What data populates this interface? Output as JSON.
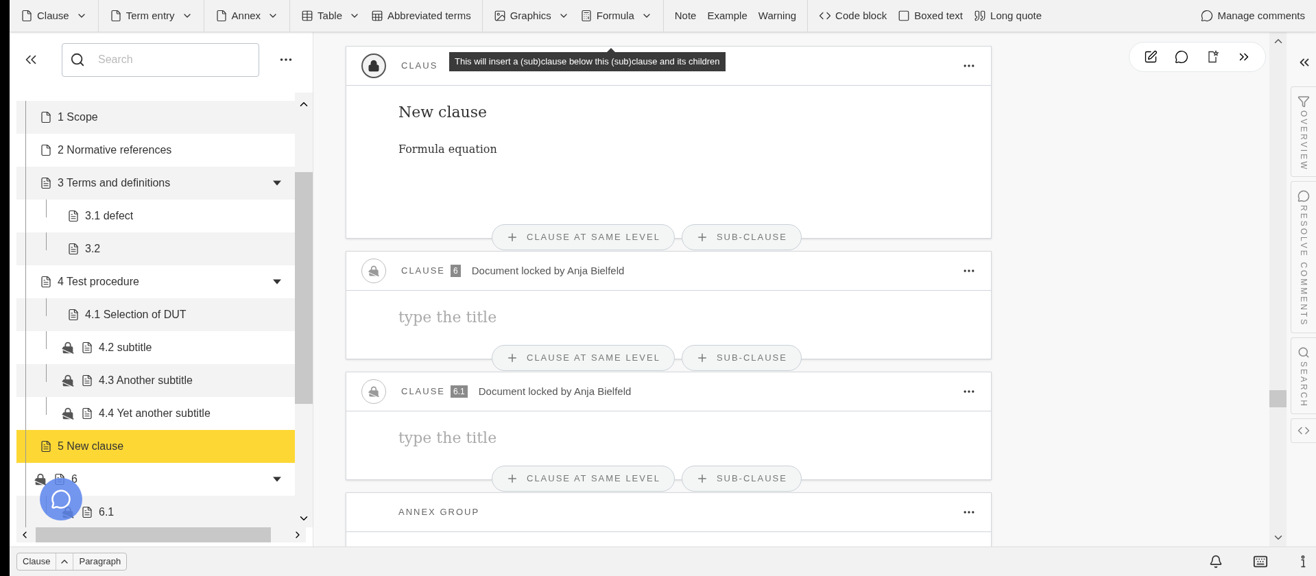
{
  "toolbar": {
    "groups": [
      [
        {
          "label": "Clause",
          "dropdown": true
        }
      ],
      [
        {
          "label": "Term entry",
          "dropdown": true
        }
      ],
      [
        {
          "label": "Annex",
          "dropdown": true
        }
      ],
      [
        {
          "label": "Table",
          "dropdown": true
        },
        {
          "label": "Abbreviated terms",
          "dropdown": false
        }
      ],
      [
        {
          "label": "Graphics",
          "dropdown": true
        },
        {
          "label": "Formula",
          "dropdown": true
        }
      ],
      [
        {
          "label": "Note",
          "dropdown": false
        },
        {
          "label": "Example",
          "dropdown": false
        },
        {
          "label": "Warning",
          "dropdown": false
        }
      ],
      [
        {
          "label": "Code block",
          "dropdown": false
        },
        {
          "label": "Boxed text",
          "dropdown": false
        },
        {
          "label": "Long quote",
          "dropdown": false
        }
      ]
    ],
    "manage_comments": "Manage comments"
  },
  "sidebar": {
    "search": {
      "placeholder": "Search"
    },
    "tree": [
      {
        "kind": "blank",
        "label": "1 Scope",
        "locked": false,
        "selected": false
      },
      {
        "kind": "blank",
        "label": "2 Normative references",
        "locked": false,
        "selected": false
      },
      {
        "kind": "text",
        "label": "3 Terms and definitions",
        "locked": false,
        "selected": false,
        "expanded": true,
        "children": [
          {
            "kind": "text",
            "label": "3.1 defect",
            "locked": false,
            "selected": false
          },
          {
            "kind": "text",
            "label": "3.2",
            "locked": false,
            "selected": false
          }
        ]
      },
      {
        "kind": "text",
        "label": "4 Test procedure",
        "locked": false,
        "selected": false,
        "expanded": true,
        "children": [
          {
            "kind": "text",
            "label": "4.1 Selection of DUT",
            "locked": false,
            "selected": false
          },
          {
            "kind": "text",
            "label": "4.2 subtitle",
            "locked": true,
            "selected": false
          },
          {
            "kind": "text",
            "label": "4.3 Another subtitle",
            "locked": true,
            "selected": false
          },
          {
            "kind": "text",
            "label": "4.4 Yet another subtitle",
            "locked": true,
            "selected": false
          }
        ]
      },
      {
        "kind": "text",
        "label": "5 New clause",
        "locked": false,
        "selected": true
      },
      {
        "kind": "text",
        "label": "6",
        "locked": true,
        "selected": false,
        "expanded": true,
        "children": [
          {
            "kind": "text",
            "label": "6.1",
            "locked": true,
            "selected": false
          }
        ]
      }
    ]
  },
  "cards": [
    {
      "kind": "clause",
      "locked_by_me": true,
      "label": "CLAUS",
      "tooltip": "This will insert a (sub)clause below this (sub)clause and its children",
      "title": "New clause",
      "body": "Formula equation",
      "buttons": [
        "CLAUSE AT SAME LEVEL",
        "SUB-CLAUSE"
      ]
    },
    {
      "kind": "clause",
      "locked_by_me": false,
      "label": "CLAUSE",
      "number": "6",
      "locked_by": "Document locked by Anja Bielfeld",
      "title_placeholder": "type the title",
      "buttons": [
        "CLAUSE AT SAME LEVEL",
        "SUB-CLAUSE"
      ]
    },
    {
      "kind": "clause",
      "locked_by_me": false,
      "label": "CLAUSE",
      "number": "6.1",
      "locked_by": "Document locked by Anja Bielfeld",
      "title_placeholder": "type the title",
      "buttons": [
        "CLAUSE AT SAME LEVEL",
        "SUB-CLAUSE"
      ]
    },
    {
      "kind": "group",
      "label": "ANNEX GROUP"
    }
  ],
  "right_rail": {
    "tabs": [
      "OVERVIEW",
      "RESOLVE COMMENTS",
      "SEARCH"
    ]
  },
  "status_bar": {
    "breadcrumb": [
      "Clause",
      "Paragraph"
    ]
  }
}
